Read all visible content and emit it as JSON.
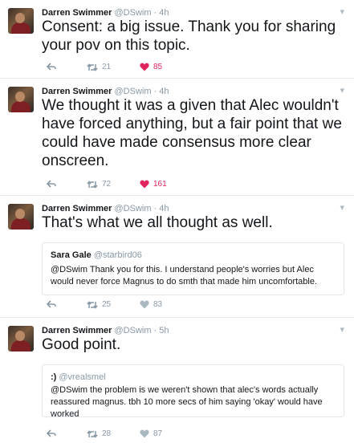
{
  "tweets": [
    {
      "name": "Darren Swimmer",
      "handle": "@DSwim",
      "time": "4h",
      "text": "Consent: a big issue. Thank you for sharing your pov on this topic.",
      "retweets": "21",
      "likes": "85",
      "liked": true
    },
    {
      "name": "Darren Swimmer",
      "handle": "@DSwim",
      "time": "4h",
      "text": "We thought it was a given that Alec wouldn't have forced anything, but a fair point that we could have made consensus more clear onscreen.",
      "retweets": "72",
      "likes": "161",
      "liked": true
    },
    {
      "name": "Darren Swimmer",
      "handle": "@DSwim",
      "time": "4h",
      "text": "That's what we all thought as well.",
      "quote": {
        "name": "Sara Gale",
        "handle": "@starbird06",
        "text": "@DSwim Thank you for this. I understand people's worries but Alec would never force Magnus to do smth that made him uncomfortable."
      },
      "retweets": "25",
      "likes": "83",
      "liked": false
    },
    {
      "name": "Darren Swimmer",
      "handle": "@DSwim",
      "time": "5h",
      "text": "Good point.",
      "quote": {
        "name": ":)",
        "handle": "@vrealsmel",
        "text": "@DSwim the problem is we weren't shown that alec's words actually reassured magnus. tbh 10 more secs of him saying 'okay' would have worked"
      },
      "retweets": "28",
      "likes": "87",
      "liked": false
    }
  ],
  "icons": {
    "reply": "reply-icon",
    "retweet": "retweet-icon",
    "like": "heart-icon",
    "more": "chevron-down-icon"
  },
  "colors": {
    "like_active": "#e0245e",
    "meta_gray": "#8899a6",
    "divider": "#e6ecf0"
  }
}
